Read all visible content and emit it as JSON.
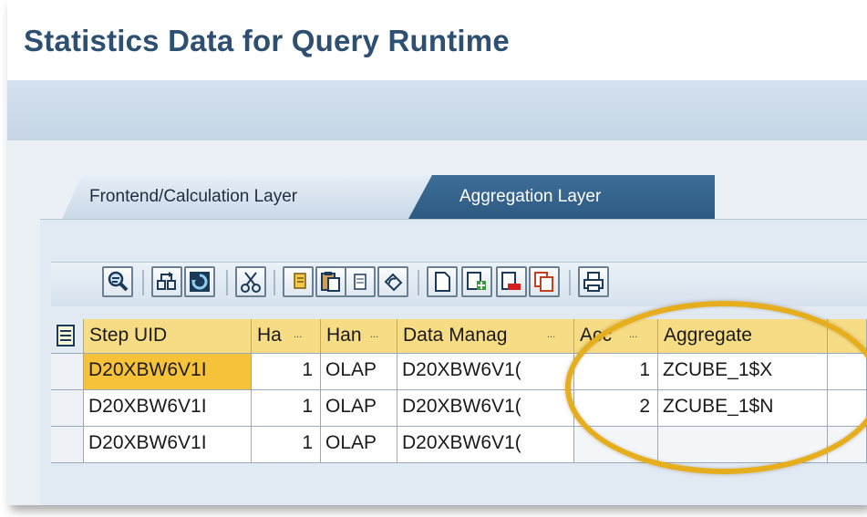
{
  "page": {
    "title": "Statistics Data for Query Runtime"
  },
  "tabs": [
    {
      "label": "Frontend/Calculation Layer",
      "active": false
    },
    {
      "label": "Aggregation Layer",
      "active": true
    }
  ],
  "toolbar": {
    "buttons": [
      "details-icon",
      "sort-icon",
      "refresh-icon",
      "cut-icon",
      "copy-icon",
      "paste-icon",
      "paste-text-icon",
      "undo-icon",
      "new-row-icon",
      "insert-row-icon",
      "delete-row-icon",
      "duplicate-row-icon",
      "print-icon"
    ]
  },
  "grid": {
    "columns": [
      "Step UID",
      "Ha",
      "Han",
      "Data Manag",
      "Acc",
      "Aggregate",
      ""
    ],
    "rows": [
      {
        "step_uid": "D20XBW6V1I",
        "ha": "1",
        "han": "OLAP",
        "data_manag": "D20XBW6V1(",
        "acc": "1",
        "aggregate": "ZCUBE_1$X",
        "extra": ""
      },
      {
        "step_uid": "D20XBW6V1I",
        "ha": "1",
        "han": "OLAP",
        "data_manag": "D20XBW6V1(",
        "acc": "2",
        "aggregate": "ZCUBE_1$N",
        "extra": ""
      },
      {
        "step_uid": "D20XBW6V1I",
        "ha": "1",
        "han": "OLAP",
        "data_manag": "D20XBW6V1(",
        "acc": "",
        "aggregate": "",
        "extra": ""
      }
    ]
  },
  "colors": {
    "title": "#2d4f72",
    "header_band": "#c6d6e6",
    "active_tab": "#2e5a82",
    "grid_header": "#f6dc84",
    "selected_cell": "#f5c23a",
    "highlight_oval": "#e6ad1c"
  }
}
